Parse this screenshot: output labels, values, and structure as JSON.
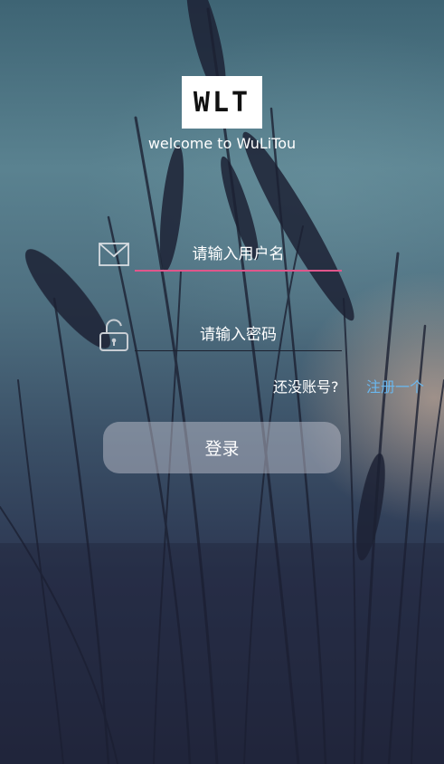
{
  "app": {
    "logo_text": "WLT",
    "welcome_text": "welcome to WuLiTou"
  },
  "form": {
    "username_placeholder": "请输入用户名",
    "password_placeholder": "请输入密码",
    "no_account_text": "还没账号?",
    "register_link_text": "注册一个",
    "login_button_label": "登录"
  },
  "colors": {
    "username_underline": "#e0568b",
    "register_link": "#6ab7ee"
  },
  "icons": {
    "username": "envelope-icon",
    "password": "unlocked-padlock-icon"
  }
}
